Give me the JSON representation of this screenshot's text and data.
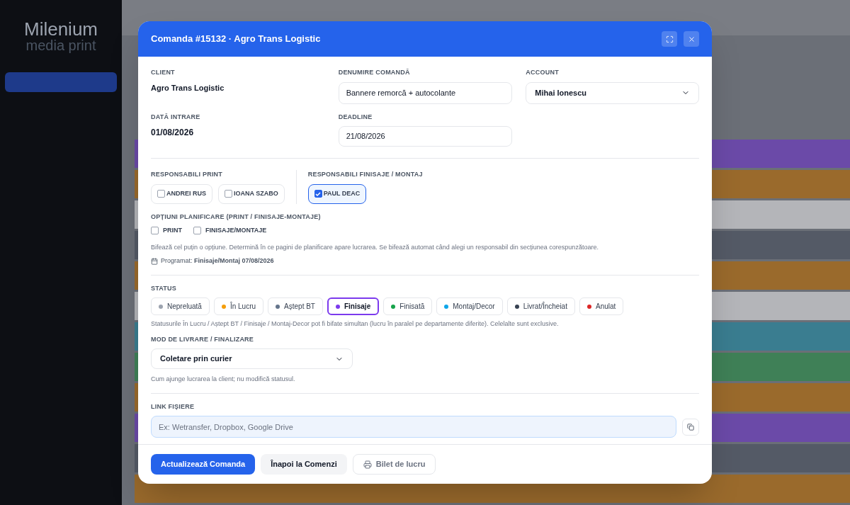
{
  "backdrop": {
    "logo": {
      "line_1": "Milenium",
      "line_2": "media print"
    },
    "rows": [
      {
        "color": "#6b4aa8"
      },
      {
        "color": "#9a6a2c"
      },
      {
        "color": "#b4b5b9"
      },
      {
        "color": "#545a66"
      },
      {
        "color": "#9a6a2c"
      },
      {
        "color": "#b4b5b9"
      },
      {
        "color": "#3a7d90"
      },
      {
        "color": "#3f8057"
      },
      {
        "color": "#9a6a2c"
      },
      {
        "color": "#6b4aa8"
      },
      {
        "color": "#545a66"
      },
      {
        "color": "#9a6a2c"
      }
    ]
  },
  "modal": {
    "title": "Comanda #15132 · Agro Trans Logistic",
    "client": {
      "label": "CLIENT",
      "value": "Agro Trans Logistic"
    },
    "order_name": {
      "label": "DENUMIRE COMANDĂ",
      "value": "Bannere remorcă + autocolante"
    },
    "account": {
      "label": "ACCOUNT",
      "value": "Mihai Ionescu"
    },
    "entry_date": {
      "label": "DATĂ INTRARE",
      "value": "01/08/2026"
    },
    "deadline": {
      "label": "DEADLINE",
      "value": "21/08/2026"
    },
    "print_responsibles": {
      "label": "RESPONSABILI PRINT",
      "people": [
        {
          "name": "ANDREI RUS",
          "checked": false
        },
        {
          "name": "IOANA SZABO",
          "checked": false
        }
      ]
    },
    "finishing_responsibles": {
      "label": "RESPONSABILI FINISAJE / MONTAJ",
      "people": [
        {
          "name": "PAUL DEAC",
          "checked": true
        }
      ]
    },
    "planning": {
      "label": "OPȚIUNI PLANIFICARE (PRINT / FINISAJE-MONTAJE)",
      "options": [
        {
          "label": "PRINT",
          "checked": false
        },
        {
          "label": "FINISAJE/MONTAJE",
          "checked": false
        }
      ],
      "hint": "Bifează cel puțin o opțiune. Determină în ce pagini de planificare apare lucrarea. Se bifează automat când alegi un responsabil din secțiunea corespunzătoare.",
      "scheduled": "Programat: **Finisaje/Montaj 07/08/2026**"
    },
    "status": {
      "label": "STATUS",
      "options": [
        {
          "label": "Nepreluată",
          "color": "#9ca3af",
          "selected": false
        },
        {
          "label": "În Lucru",
          "color": "#f59e0b",
          "selected": false
        },
        {
          "label": "Aștept BT",
          "color": "#64748b",
          "selected": false
        },
        {
          "label": "Finisaje",
          "color": "#7c3aed",
          "selected": true
        },
        {
          "label": "Finisată",
          "color": "#16a34a",
          "selected": false
        },
        {
          "label": "Montaj/Decor",
          "color": "#0ea5e9",
          "selected": false
        },
        {
          "label": "Livrat/Încheiat",
          "color": "#374151",
          "selected": false
        },
        {
          "label": "Anulat",
          "color": "#dc2626",
          "selected": false
        }
      ],
      "hint": "Statusurile În Lucru / Aștept BT / Finisaje / Montaj-Decor pot fi bifate simultan (lucru în paralel pe departamente diferite). Celelalte sunt exclusive."
    },
    "delivery": {
      "label": "MOD DE LIVRARE / FINALIZARE",
      "value": "Coletare prin curier",
      "hint": "Cum ajunge lucrarea la client; nu modifică statusul."
    },
    "files_link": {
      "label": "LINK FIȘIERE",
      "placeholder": "Ex: Wetransfer, Dropbox, Google Drive"
    },
    "buttons": [
      {
        "label": "Actualizează Comanda",
        "kind": "primary"
      },
      {
        "label": "Înapoi la Comenzi",
        "kind": "secondary"
      },
      {
        "label": "Bilet de lucru",
        "kind": "print"
      }
    ]
  }
}
